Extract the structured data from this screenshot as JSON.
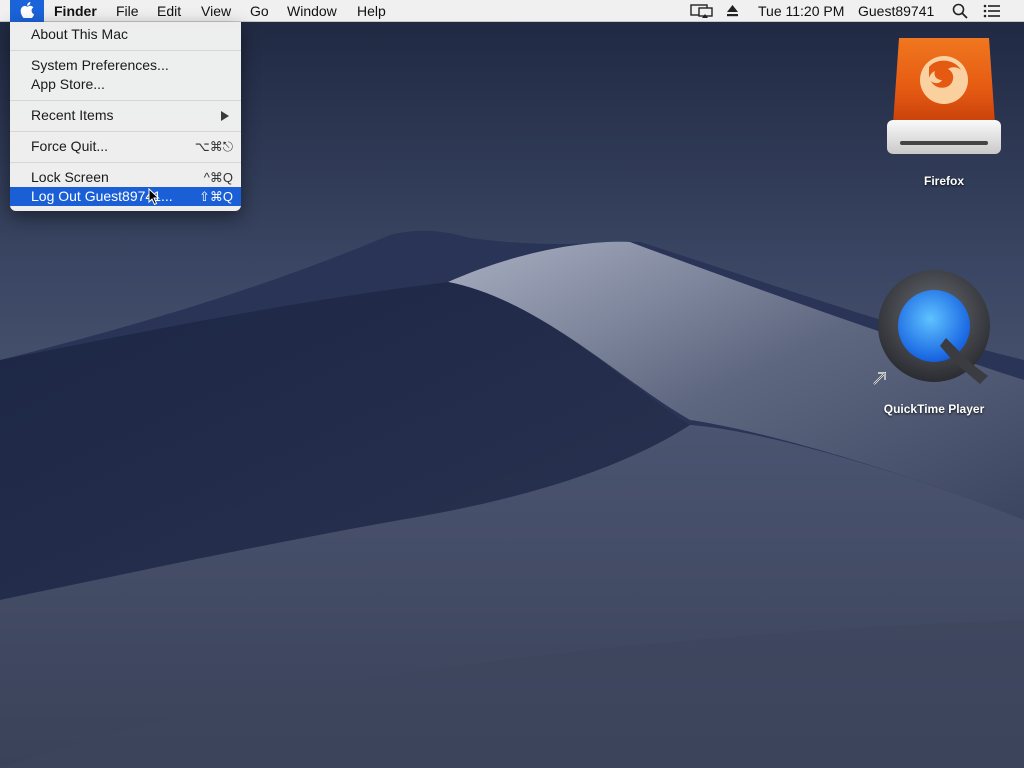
{
  "menubar": {
    "apple_icon": "apple-logo-icon",
    "app_name": "Finder",
    "menus": [
      "File",
      "Edit",
      "View",
      "Go",
      "Window",
      "Help"
    ],
    "status": {
      "display_icon": "airplay-display-icon",
      "eject_icon": "eject-icon",
      "clock": "Tue 11:20 PM",
      "user": "Guest89741",
      "search_icon": "spotlight-search-icon",
      "notifications_icon": "notification-center-icon"
    }
  },
  "apple_menu": {
    "about": "About This Mac",
    "system_preferences": "System Preferences...",
    "app_store": "App Store...",
    "recent_items": "Recent Items",
    "force_quit": "Force Quit...",
    "force_quit_shortcut": "⌥⌘⎋",
    "lock_screen": "Lock Screen",
    "lock_screen_shortcut": "^⌘Q",
    "log_out": "Log Out Guest89741...",
    "log_out_shortcut": "⇧⌘Q"
  },
  "desktop": {
    "icons": [
      {
        "label": "Firefox",
        "icon": "firefox-drive-icon"
      },
      {
        "label": "QuickTime Player",
        "icon": "quicktime-player-icon",
        "alias": true
      }
    ]
  },
  "colors": {
    "menubar_bg": "#f0f0f0",
    "highlight": "#1b5fd6",
    "wallpaper_sky": "#2c3450"
  }
}
